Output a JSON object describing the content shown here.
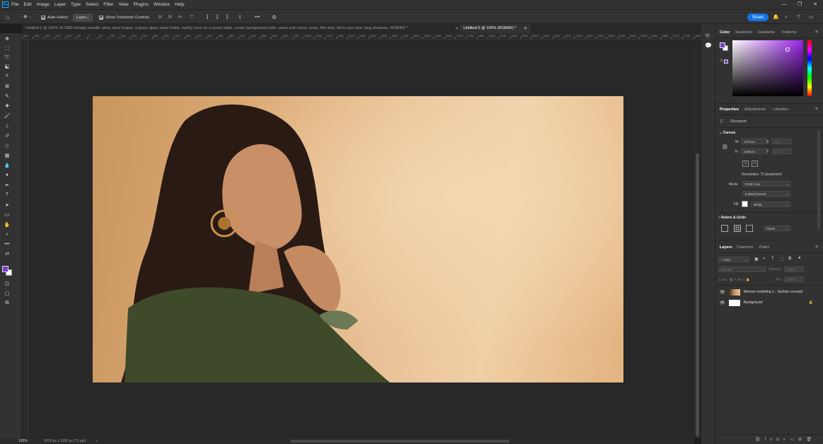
{
  "menubar": {
    "logo": "Ps",
    "items": [
      "File",
      "Edit",
      "Image",
      "Layer",
      "Type",
      "Select",
      "Filter",
      "View",
      "Plugins",
      "Window",
      "Help"
    ]
  },
  "options": {
    "auto_select_label": "Auto-Select:",
    "auto_select_value": "Layer",
    "show_transform_label": "Show Transform Controls",
    "share_label": "Share"
  },
  "tabs": [
    {
      "label": "Untitled-1 @ 100% (A 1960 vintage metallic shiny silver teapot, a green glass water bottle, earthy hues on a cream table, cream background walls, warm and sunny, rustic, film look, bird's eye view, long shadows, RGB/8#) *",
      "active": false
    },
    {
      "label": "Untitled-2 @ 100% (RGB/8#) *",
      "active": true
    }
  ],
  "ruler": {
    "labels": [
      "300",
      "250",
      "200",
      "150",
      "100",
      "50",
      "0",
      "50",
      "100",
      "150",
      "200",
      "250",
      "300",
      "350",
      "400",
      "450",
      "500",
      "550",
      "600",
      "650",
      "700",
      "750",
      "800",
      "850",
      "900",
      "950",
      "1000",
      "1050",
      "1100",
      "1150",
      "1200",
      "1250",
      "1300",
      "1350",
      "1400",
      "1450",
      "1500",
      "1550",
      "1600",
      "1650",
      "1700",
      "1750",
      "1800",
      "1850",
      "1900",
      "1950",
      "2000",
      "2050",
      "2100",
      "2150",
      "2200",
      "2250",
      "2300",
      "2350",
      "2400",
      "2450",
      "2500",
      "2550",
      "2600",
      "2650",
      "2700",
      "2750",
      "2800"
    ]
  },
  "status": {
    "zoom": "100%",
    "doc_size": "2476 px x 1335 px (72 ppi)"
  },
  "color_panel": {
    "tabs": [
      "Color",
      "Swatches",
      "Gradients",
      "Patterns"
    ],
    "foreground": "#7a3fd0",
    "background": "#ffffff"
  },
  "properties_panel": {
    "tabs": [
      "Properties",
      "Adjustments",
      "Libraries"
    ],
    "document_label": "Document",
    "canvas_label": "Canvas",
    "w_label": "W",
    "w_value": "2476 px",
    "h_label": "H",
    "h_value": "1335 px",
    "x_label": "X",
    "x_value": "0 px",
    "y_label": "Y",
    "y_value": "0 px",
    "resolution": "Resolution: 72 pixels/inch",
    "mode_label": "Mode",
    "mode_value": "RGB Color",
    "bits_value": "8 Bits/Channel",
    "fill_label": "Fill",
    "fill_value": "White",
    "rulers_label": "Rulers & Grids",
    "units_value": "Pixels"
  },
  "layers_panel": {
    "tabs": [
      "Layers",
      "Channels",
      "Paths"
    ],
    "kind_label": "Kind",
    "blend_mode": "Normal",
    "opacity_label": "Opacity:",
    "opacity_value": "100%",
    "lock_label": "Lock:",
    "fill_label": "Fill:",
    "fill_value": "100%",
    "layers": [
      {
        "name": "Woman modeling e... fashion concept",
        "italic": false,
        "locked": false
      },
      {
        "name": "Background",
        "italic": true,
        "locked": true
      }
    ]
  }
}
